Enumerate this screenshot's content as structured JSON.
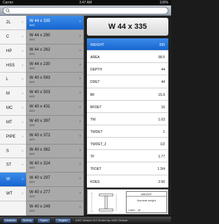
{
  "status": {
    "carrier": "Carrier",
    "time": "3:47 AM",
    "battery": "100%"
  },
  "search": {
    "placeholder": ""
  },
  "shapes": {
    "items": [
      {
        "label": "2L"
      },
      {
        "label": "C"
      },
      {
        "label": "HP"
      },
      {
        "label": "HSS"
      },
      {
        "label": "L"
      },
      {
        "label": "M"
      },
      {
        "label": "MC"
      },
      {
        "label": "MT"
      },
      {
        "label": "PIPE"
      },
      {
        "label": "S"
      },
      {
        "label": "ST"
      },
      {
        "label": "W"
      },
      {
        "label": "WT"
      },
      {
        "label": ""
      }
    ],
    "selected": "W"
  },
  "sizes": {
    "items": [
      {
        "name": "W 44 x 335",
        "source": "AISC"
      },
      {
        "name": "W 44 x 290",
        "source": "AISC"
      },
      {
        "name": "W 44 x 262",
        "source": "AISC"
      },
      {
        "name": "W 44 x 230",
        "source": "AISC"
      },
      {
        "name": "W 40 x 593",
        "source": "AISC"
      },
      {
        "name": "W 40 x 503",
        "source": "AISC"
      },
      {
        "name": "W 40 x 431",
        "source": "AISC"
      },
      {
        "name": "W 40 x 397",
        "source": "AISC"
      },
      {
        "name": "W 40 x 372",
        "source": "AISC"
      },
      {
        "name": "W 40 x 362",
        "source": "AISC"
      },
      {
        "name": "W 40 x 324",
        "source": "AISC"
      },
      {
        "name": "W 40 x 297",
        "source": "AISC"
      },
      {
        "name": "W 40 x 277",
        "source": "AISC"
      },
      {
        "name": "W 40 x 249",
        "source": "AISC"
      }
    ],
    "selected": "W 44 x 335"
  },
  "detail": {
    "title": "W 44 x 335",
    "properties": [
      {
        "key": "WEIGHT",
        "value": "335"
      },
      {
        "key": "AREA",
        "value": "98.5"
      },
      {
        "key": "DEPTH",
        "value": "44"
      },
      {
        "key": "DDET",
        "value": "44"
      },
      {
        "key": "BF",
        "value": "15.9"
      },
      {
        "key": "BFDET",
        "value": "16"
      },
      {
        "key": "TW",
        "value": "1.03"
      },
      {
        "key": "TWDET",
        "value": "1"
      },
      {
        "key": "TWDET_2",
        "value": "1/2"
      },
      {
        "key": "TF",
        "value": "1.77"
      },
      {
        "key": "TFDET",
        "value": "1  3/4"
      },
      {
        "key": "KDES",
        "value": "2.56"
      }
    ],
    "weight_box": {
      "header": "WEIGHT",
      "body": "Nominal weight",
      "label": "Label:",
      "unit": "plf"
    }
  },
  "toolbar": {
    "buttons": [
      {
        "label": "Libraries"
      },
      {
        "label": "Sort by"
      },
      {
        "label": "Types"
      },
      {
        "label": "English"
      }
    ],
    "version": "AISC Version 13.0 Sorted by: AISC Default"
  },
  "colors": {
    "accent": "#1a6fdc",
    "toolbar": "#1e1e1e"
  }
}
